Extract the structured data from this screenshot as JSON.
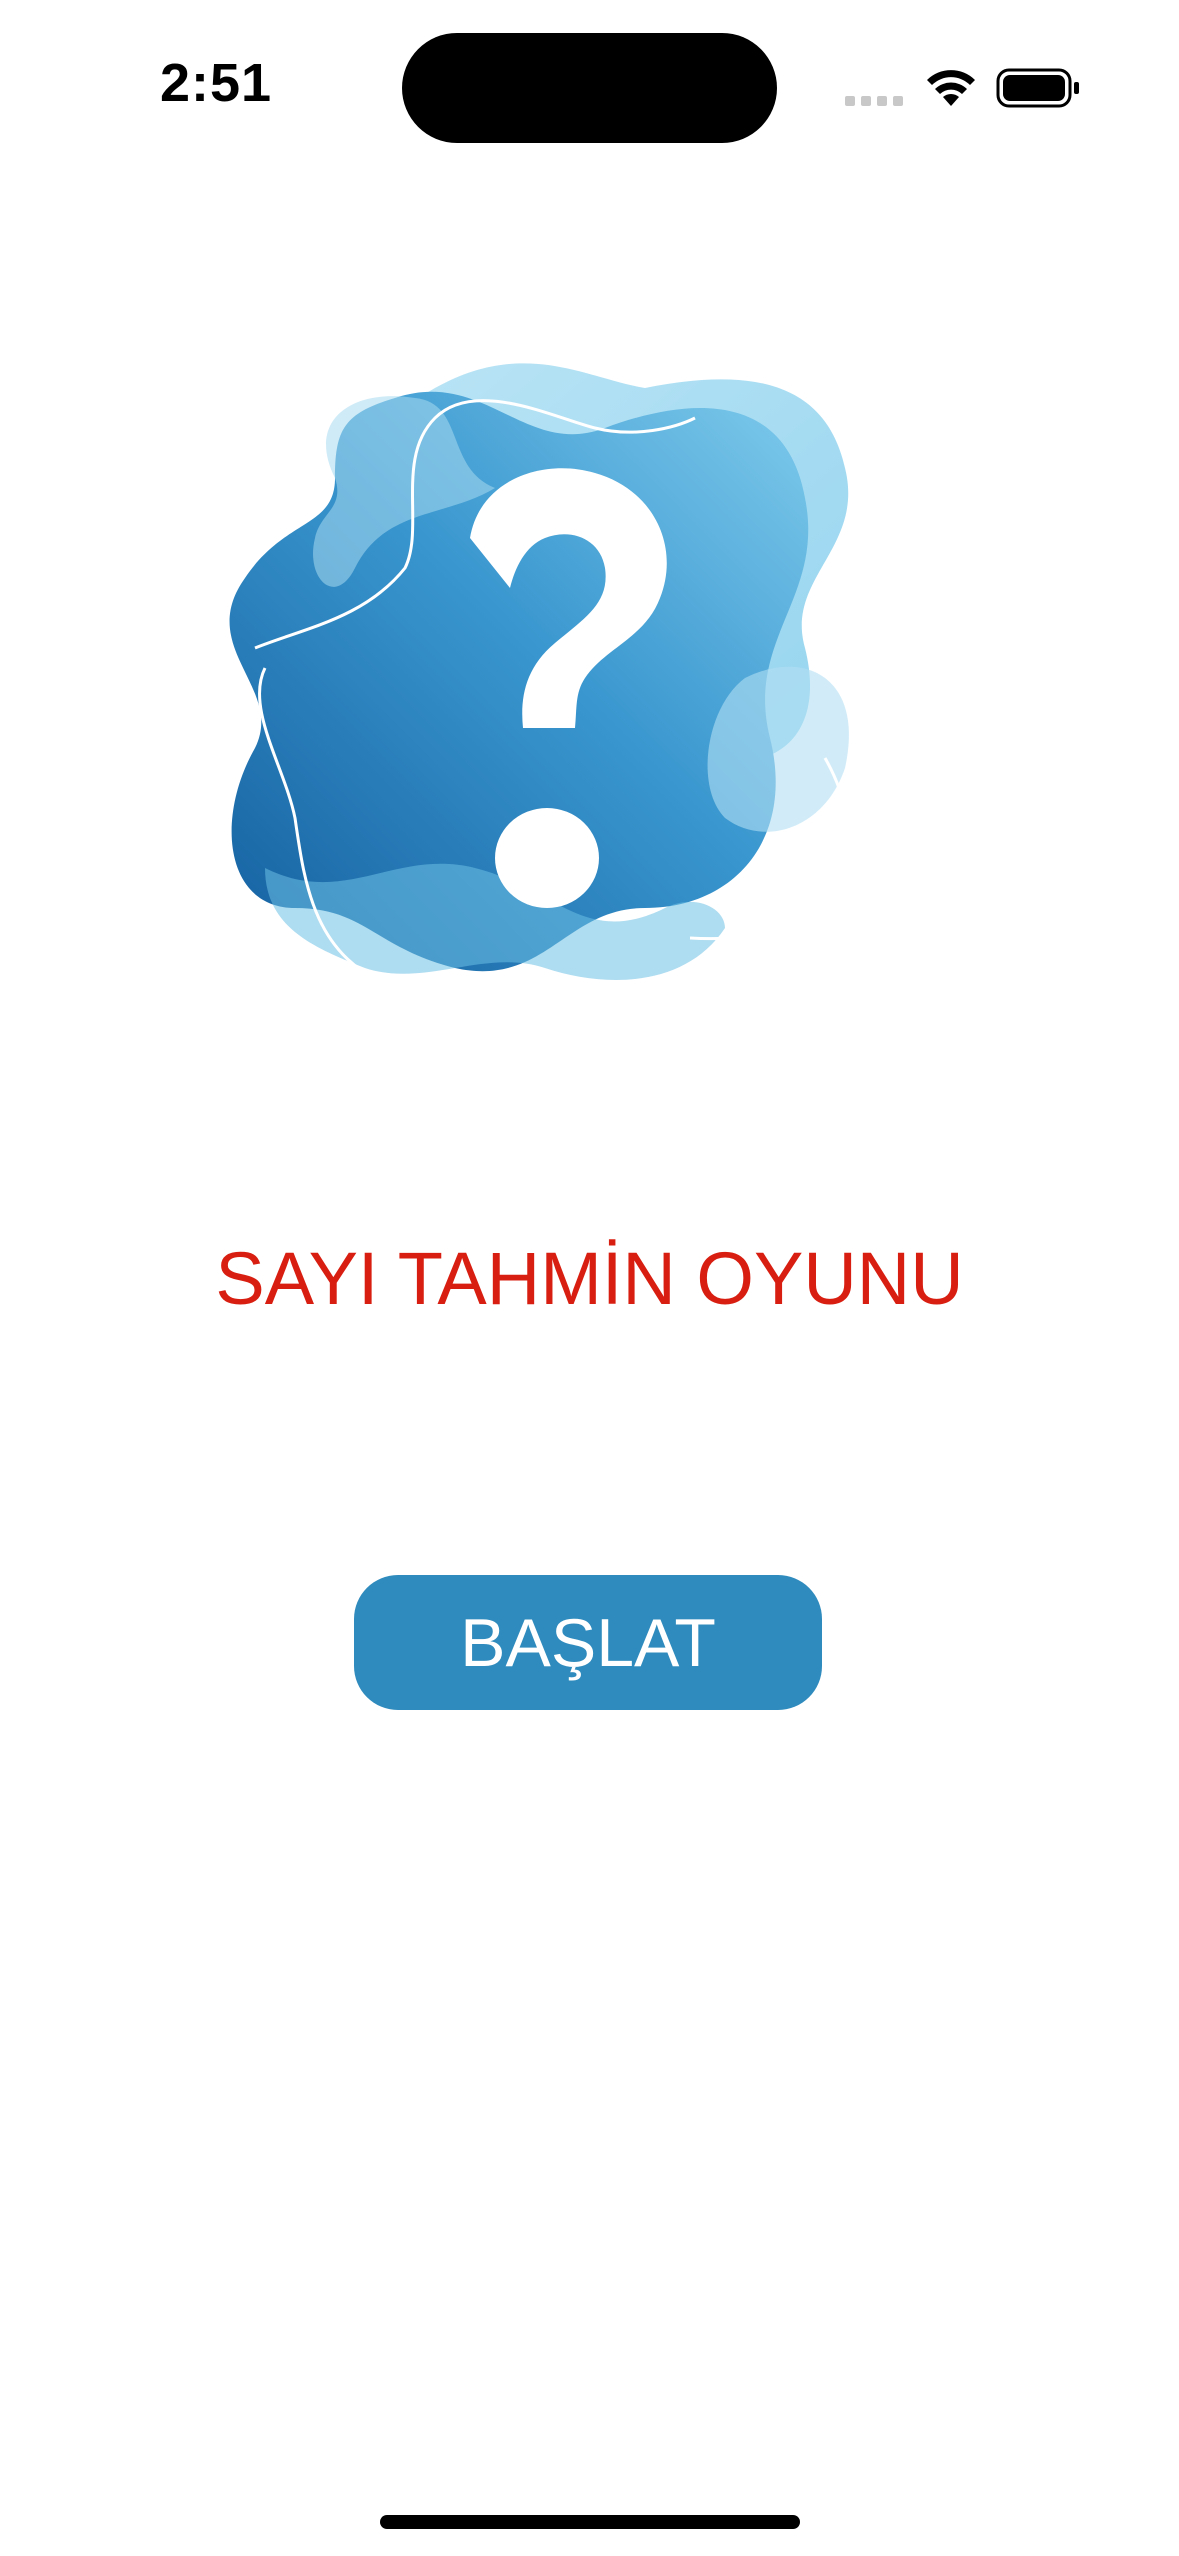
{
  "status_bar": {
    "time": "2:51",
    "signal_icon": "cellular-signal-icon",
    "wifi_icon": "wifi-icon",
    "battery_icon": "battery-icon"
  },
  "hero": {
    "icon": "question-mark-icon",
    "colors": {
      "blob_light": "#a8dcf1",
      "blob_mid": "#5fb8e2",
      "blob_dark": "#1b6eae"
    }
  },
  "title": "SAYI TAHMİN OYUNU",
  "start_button": {
    "label": "BAŞLAT"
  },
  "colors": {
    "title_red": "#d81e10",
    "button_blue": "#2f8bbd"
  }
}
